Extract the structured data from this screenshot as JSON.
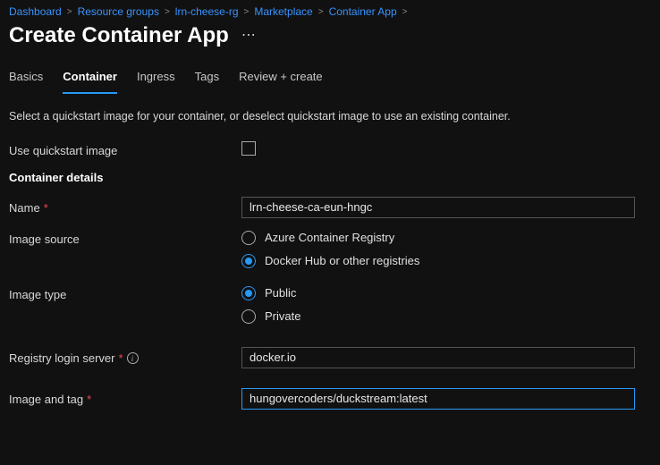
{
  "breadcrumb": [
    "Dashboard",
    "Resource groups",
    "lrn-cheese-rg",
    "Marketplace",
    "Container App"
  ],
  "title": "Create Container App",
  "tabs": [
    {
      "label": "Basics",
      "active": false
    },
    {
      "label": "Container",
      "active": true
    },
    {
      "label": "Ingress",
      "active": false
    },
    {
      "label": "Tags",
      "active": false
    },
    {
      "label": "Review + create",
      "active": false
    }
  ],
  "intro": "Select a quickstart image for your container, or deselect quickstart image to use an existing container.",
  "quickstart_label": "Use quickstart image",
  "quickstart_checked": false,
  "section_container_details": "Container details",
  "name_label": "Name",
  "name_value": "lrn-cheese-ca-eun-hngc",
  "image_source_label": "Image source",
  "image_source_options": [
    {
      "label": "Azure Container Registry",
      "selected": false
    },
    {
      "label": "Docker Hub or other registries",
      "selected": true
    }
  ],
  "image_type_label": "Image type",
  "image_type_options": [
    {
      "label": "Public",
      "selected": true
    },
    {
      "label": "Private",
      "selected": false
    }
  ],
  "registry_label": "Registry login server",
  "registry_value": "docker.io",
  "image_tag_label": "Image and tag",
  "image_tag_value": "hungovercoders/duckstream:latest"
}
